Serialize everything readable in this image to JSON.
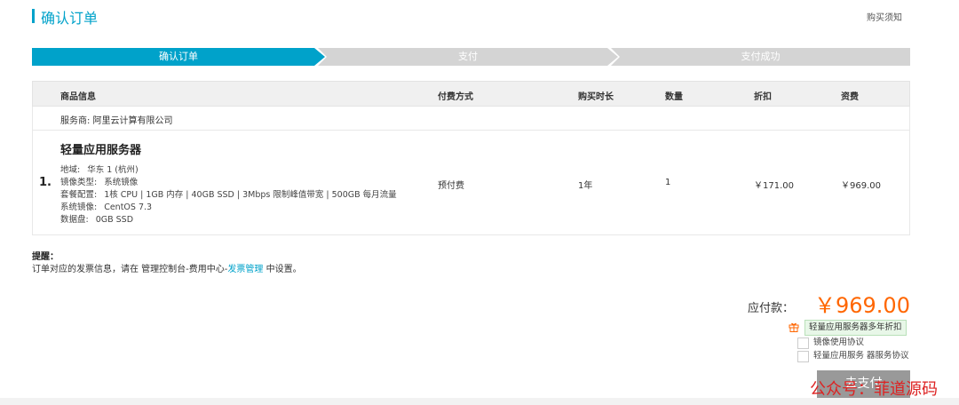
{
  "header": {
    "title": "确认订单",
    "notice_link": "购买须知"
  },
  "steps": [
    {
      "label": "确认订单",
      "active": true
    },
    {
      "label": "支付",
      "active": false
    },
    {
      "label": "支付成功",
      "active": false
    }
  ],
  "table": {
    "headers": [
      "商品信息",
      "付费方式",
      "购买时长",
      "数量",
      "折扣",
      "资费"
    ],
    "provider": "服务商: 阿里云计算有限公司",
    "row": {
      "index": "1.",
      "product_name": "轻量应用服务器",
      "specs": [
        {
          "key": "地域:",
          "value": "华东 1 (杭州)"
        },
        {
          "key": "镜像类型:",
          "value": "系统镜像"
        },
        {
          "key": "套餐配置:",
          "value": "1核 CPU | 1GB 内存 | 40GB SSD | 3Mbps 限制峰值带宽 | 500GB 每月流量"
        },
        {
          "key": "系统镜像:",
          "value": "CentOS 7.3"
        },
        {
          "key": "数据盘:",
          "value": "0GB SSD"
        }
      ],
      "payment_method": "预付费",
      "duration": "1年",
      "quantity": "1",
      "discount": "￥171.00",
      "price": "￥969.00"
    }
  },
  "reminder": {
    "title": "提醒：",
    "text_before": "订单对应的发票信息，请在 管理控制台-费用中心-",
    "link": "发票管理",
    "text_after": " 中设置。"
  },
  "payment": {
    "label": "应付款：",
    "amount": "￥969.00",
    "discount_tag": "轻量应用服务器多年折扣",
    "agreements": [
      "镜像使用协议",
      "轻量应用服务 器服务协议"
    ],
    "button": "去支付"
  },
  "watermark": "公众号：菲道源码",
  "colors": {
    "accent": "#00a2ca",
    "price": "#ff6600",
    "step_inactive": "#d4d4d4"
  }
}
